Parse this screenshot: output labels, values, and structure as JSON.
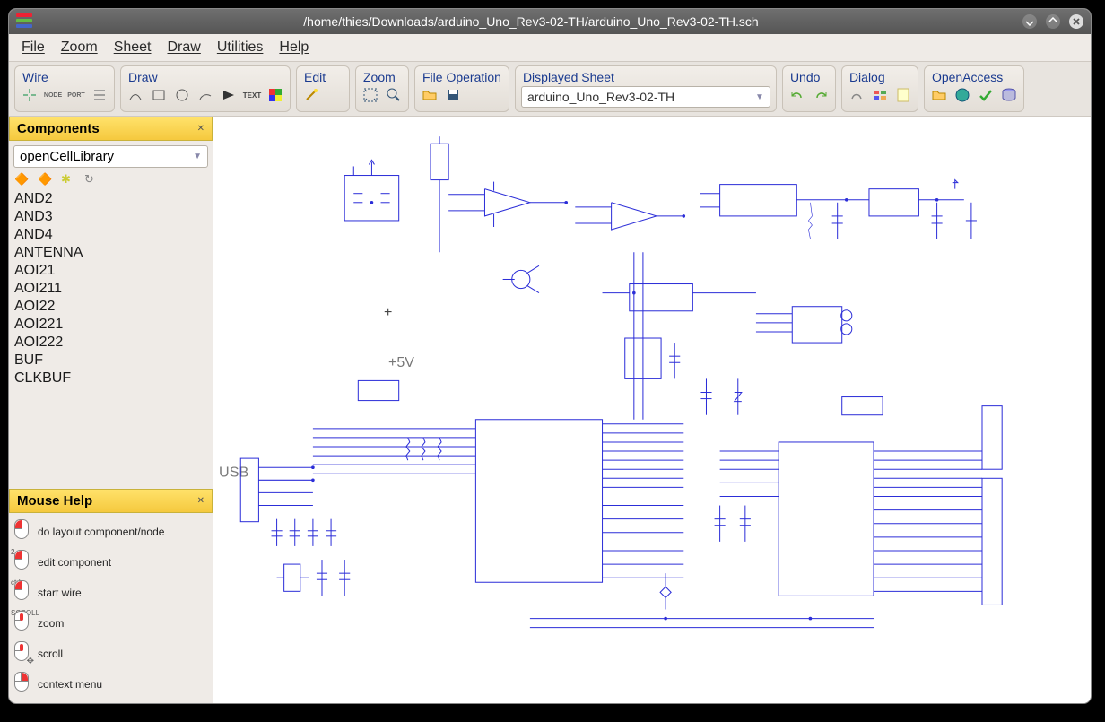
{
  "window": {
    "title": "/home/thies/Downloads/arduino_Uno_Rev3-02-TH/arduino_Uno_Rev3-02-TH.sch"
  },
  "menubar": {
    "file": "File",
    "zoom": "Zoom",
    "sheet": "Sheet",
    "draw": "Draw",
    "utilities": "Utilities",
    "help": "Help"
  },
  "toolbar": {
    "wire_label": "Wire",
    "draw_label": "Draw",
    "edit_label": "Edit",
    "zoom_label": "Zoom",
    "fileop_label": "File Operation",
    "displayed_label": "Displayed Sheet",
    "displayed_value": "arduino_Uno_Rev3-02-TH",
    "undo_label": "Undo",
    "dialog_label": "Dialog",
    "oa_label": "OpenAccess"
  },
  "components": {
    "header": "Components",
    "library_value": "openCellLibrary",
    "items": [
      "AND2",
      "AND3",
      "AND4",
      "ANTENNA",
      "AOI21",
      "AOI211",
      "AOI22",
      "AOI221",
      "AOI222",
      "BUF",
      "CLKBUF"
    ]
  },
  "mousehelp": {
    "header": "Mouse Help",
    "rows": [
      {
        "label": "do layout component/node"
      },
      {
        "label": "edit component"
      },
      {
        "label": "start wire"
      },
      {
        "label": "zoom"
      },
      {
        "label": "scroll"
      },
      {
        "label": "context menu"
      }
    ],
    "ctrl_tag": "ctrl",
    "scroll_tag": "SCROLL"
  },
  "canvas": {
    "voltage_label": "+5V",
    "usb_label": "USB"
  }
}
